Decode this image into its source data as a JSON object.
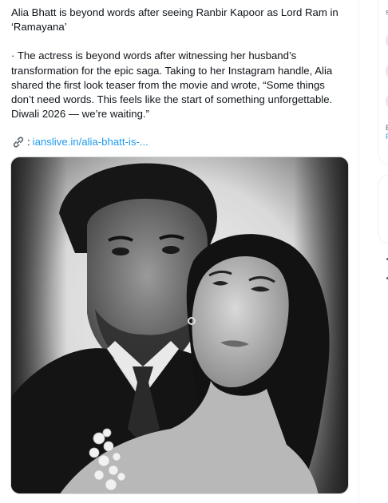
{
  "tweet": {
    "line1": "Alia Bhatt is beyond words after seeing Ranbir Kapoor as Lord Ram in",
    "line2": "‘Ramayana’",
    "body_line1": "· The actress is beyond words after witnessing her husband’s",
    "body_line2": "transformation for the epic saga. Taking to her Instagram handle, Alia",
    "body_line3": "shared the first look teaser from the movie and wrote, “Some things",
    "body_line4": "don’t need words. This feels like the start of something unforgettable.",
    "body_line5": "Diwali 2026 — we’re waiting.”",
    "link_colon": ":",
    "link_text": "ianslive.in/alia-bhatt-is-..."
  },
  "sidebar": {
    "fragment_e": "E",
    "fragment_f": "F",
    "fragment_s": "s"
  },
  "icons": {
    "link": "link-icon"
  }
}
